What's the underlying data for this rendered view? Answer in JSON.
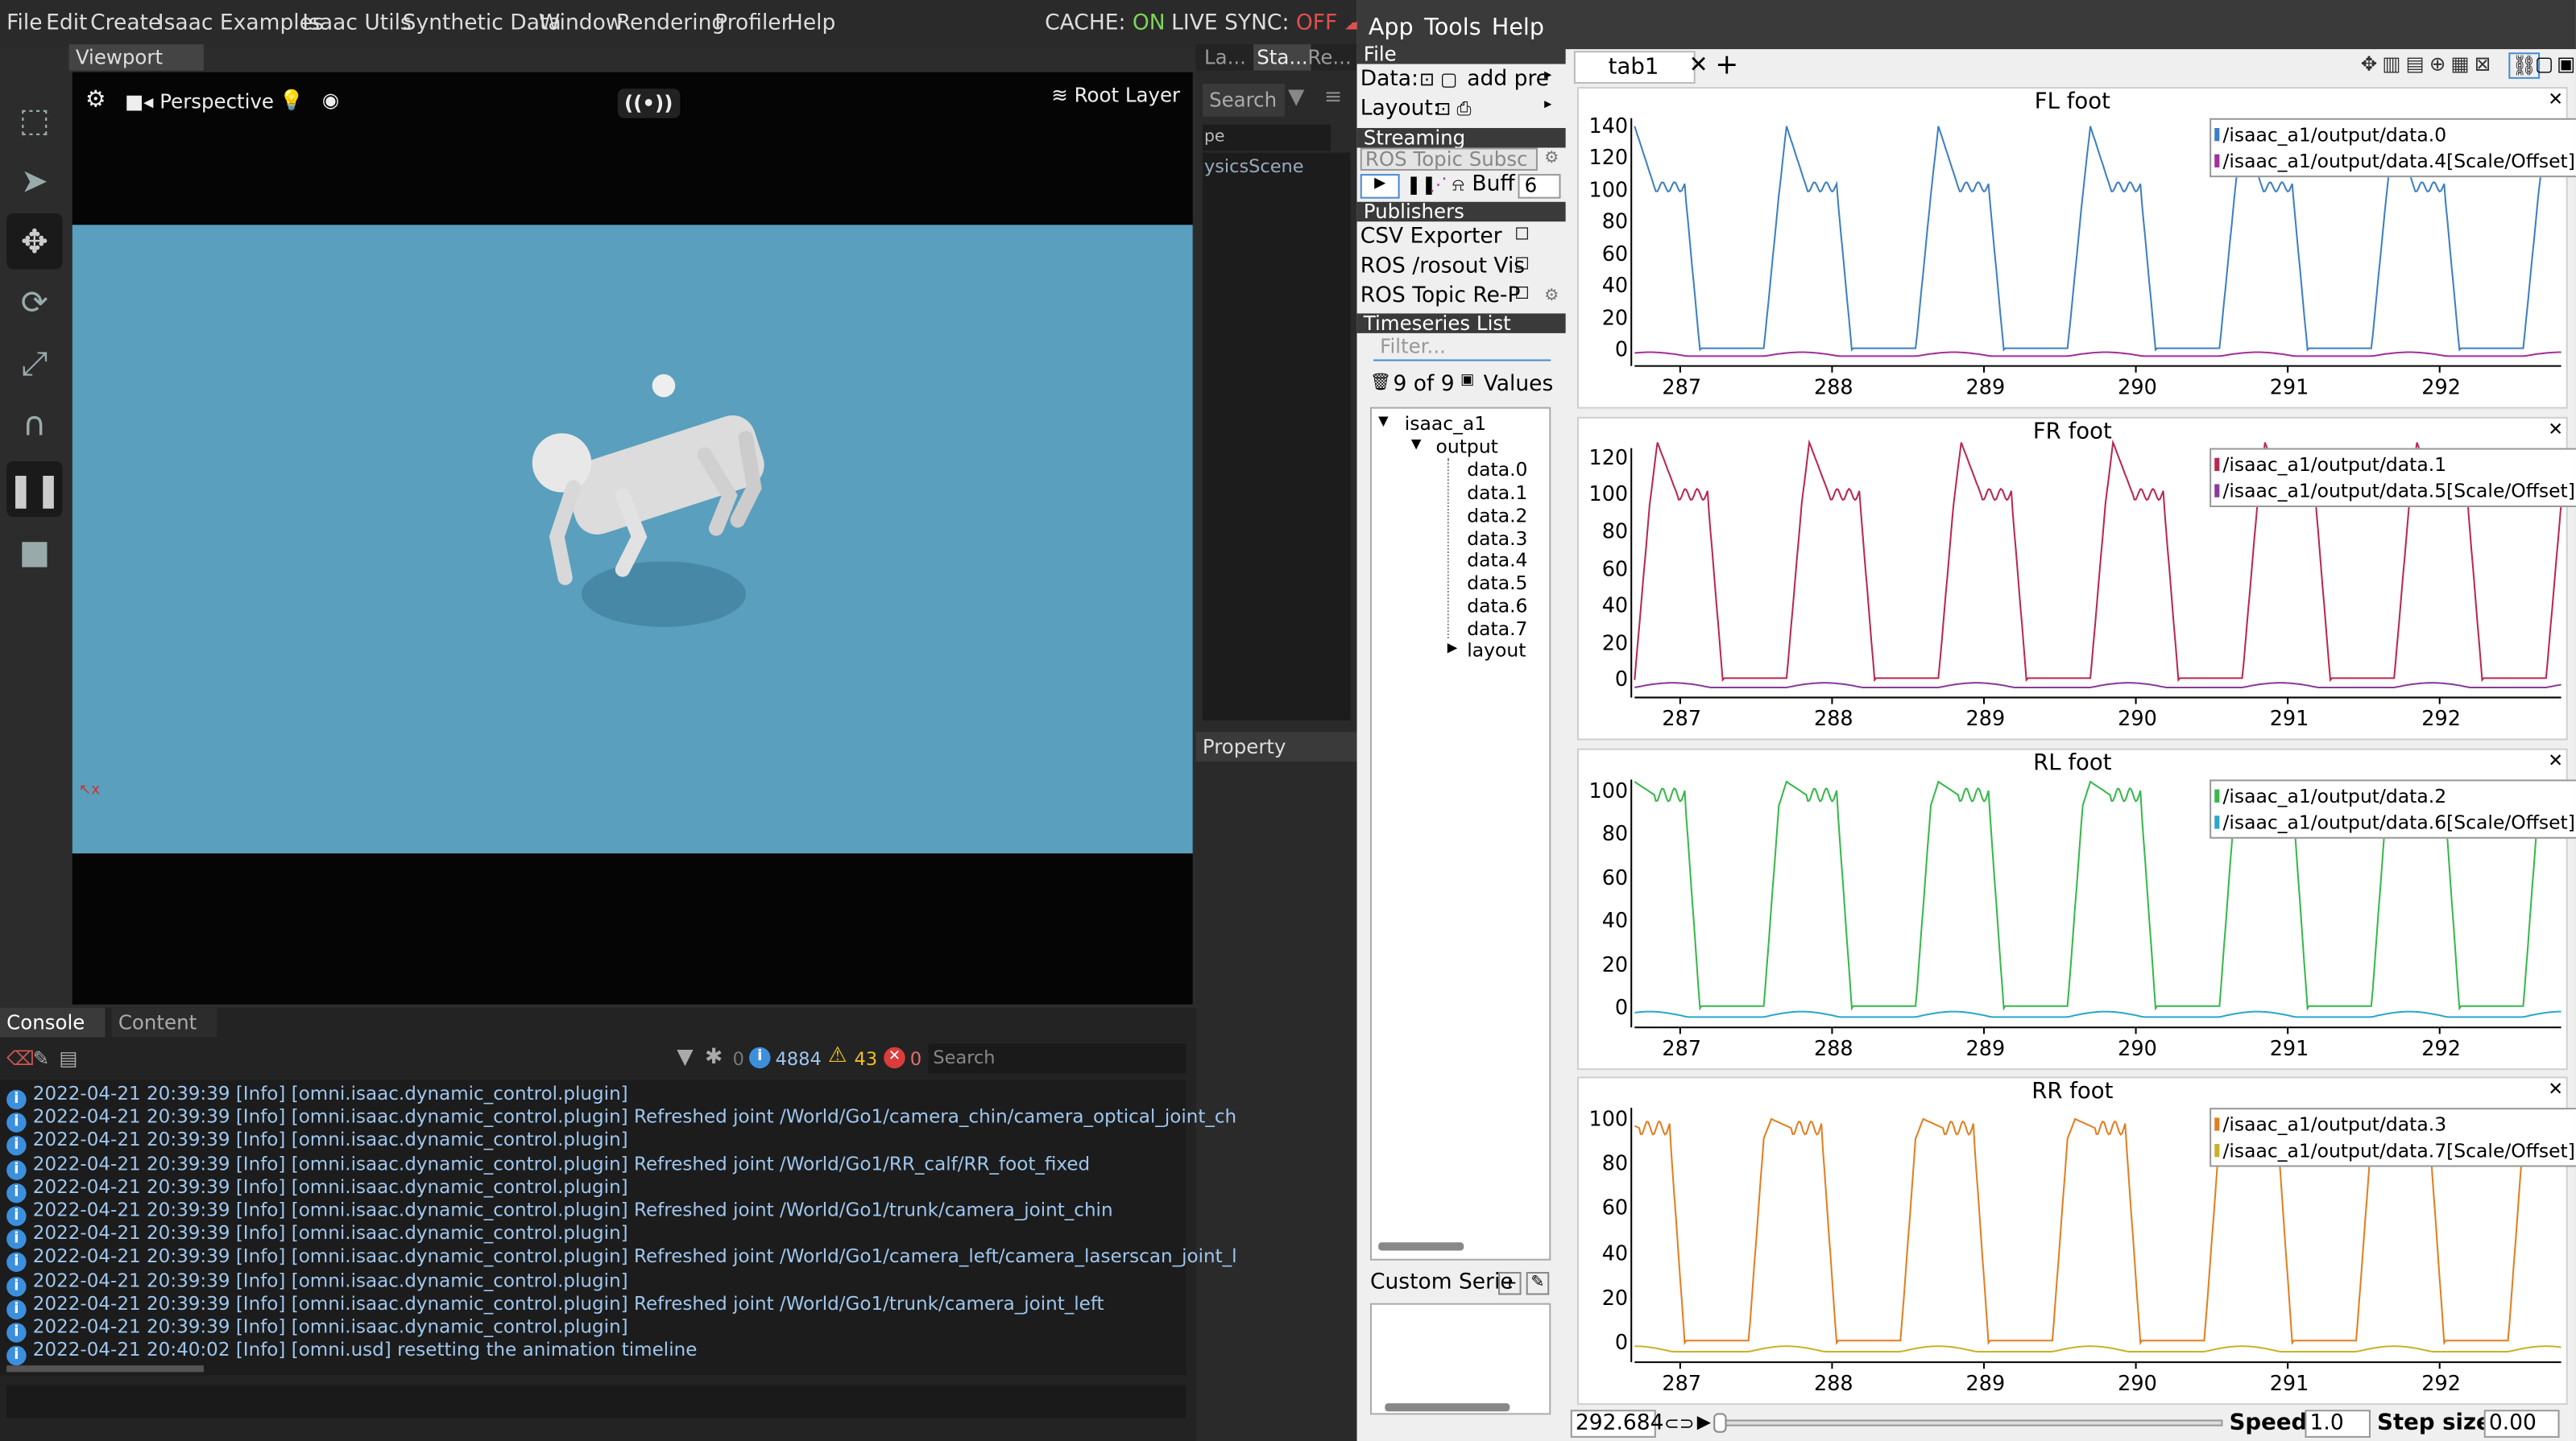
{
  "menu": {
    "items": [
      "File",
      "Edit",
      "Create",
      "Isaac Examples",
      "Isaac Utils",
      "Synthetic Data",
      "Window",
      "Rendering",
      "Profiler",
      "Help"
    ],
    "cache_label": "CACHE:",
    "cache_value": "ON",
    "live_label": "LIVE SYNC:",
    "live_value": "OFF"
  },
  "viewport": {
    "tab": "Viewport",
    "camera": "Perspective",
    "layer": "Root Layer"
  },
  "right_panel": {
    "tabs": [
      "La...",
      "Sta...",
      "Re..."
    ],
    "search": "Search",
    "row1": "pe",
    "row2": "ysicsScene",
    "property": "Property"
  },
  "console": {
    "tabs": [
      "Console",
      "Content"
    ],
    "count0": "0",
    "info_count": "4884",
    "warn_count": "43",
    "err_count": "0",
    "search": "Search",
    "lines": [
      "2022-04-21 20:39:39  [Info] [omni.isaac.dynamic_control.plugin]",
      "2022-04-21 20:39:39  [Info] [omni.isaac.dynamic_control.plugin] Refreshed joint /World/Go1/camera_chin/camera_optical_joint_ch",
      "2022-04-21 20:39:39  [Info] [omni.isaac.dynamic_control.plugin]",
      "2022-04-21 20:39:39  [Info] [omni.isaac.dynamic_control.plugin] Refreshed joint /World/Go1/RR_calf/RR_foot_fixed",
      "2022-04-21 20:39:39  [Info] [omni.isaac.dynamic_control.plugin]",
      "2022-04-21 20:39:39  [Info] [omni.isaac.dynamic_control.plugin] Refreshed joint /World/Go1/trunk/camera_joint_chin",
      "2022-04-21 20:39:39  [Info] [omni.isaac.dynamic_control.plugin]",
      "2022-04-21 20:39:39  [Info] [omni.isaac.dynamic_control.plugin] Refreshed joint /World/Go1/camera_left/camera_laserscan_joint_l",
      "2022-04-21 20:39:39  [Info] [omni.isaac.dynamic_control.plugin]",
      "2022-04-21 20:39:39  [Info] [omni.isaac.dynamic_control.plugin] Refreshed joint /World/Go1/trunk/camera_joint_left",
      "2022-04-21 20:39:39  [Info] [omni.isaac.dynamic_control.plugin]",
      "2022-04-21 20:40:02  [Info] [omni.usd] resetting the animation timeline"
    ]
  },
  "pj": {
    "menu": [
      "App",
      "Tools",
      "Help"
    ],
    "file": "File",
    "data_label": "Data:",
    "add": "add pre",
    "layout_label": "Layout:",
    "streaming": "Streaming",
    "ros_sub": "ROS Topic Subsc",
    "buff": "Buff",
    "buff_val": "6",
    "publishers": "Publishers",
    "pubs": [
      "CSV Exporter",
      "ROS /rosout Vis",
      "ROS Topic Re-P"
    ],
    "ts_list": "Timeseries List",
    "filter": "Filter...",
    "count": "9 of 9",
    "values": "Values",
    "tree": [
      "isaac_a1",
      "output",
      "data.0",
      "data.1",
      "data.2",
      "data.3",
      "data.4",
      "data.5",
      "data.6",
      "data.7",
      "layout"
    ],
    "custom": "Custom Serie",
    "tab": "tab1",
    "time": "292.684",
    "speed_label": "Speed:",
    "speed": "1.0",
    "step_label": "Step size:",
    "step": "0.00"
  },
  "chart_data": [
    {
      "type": "line",
      "title": "FL foot",
      "xlim": [
        286.7,
        292.8
      ],
      "ylim": [
        -5,
        145
      ],
      "xticks": [
        287,
        288,
        289,
        290,
        291,
        292
      ],
      "yticks": [
        0,
        20,
        40,
        60,
        80,
        100,
        120,
        140
      ],
      "series": [
        {
          "name": "/isaac_a1/output/data.0",
          "color": "#3d7fc4"
        },
        {
          "name": "/isaac_a1/output/data.4[Scale/Offset]",
          "color": "#a0309a"
        }
      ]
    },
    {
      "type": "line",
      "title": "FR foot",
      "xlim": [
        286.7,
        292.8
      ],
      "ylim": [
        -5,
        125
      ],
      "xticks": [
        287,
        288,
        289,
        290,
        291,
        292
      ],
      "yticks": [
        0,
        20,
        40,
        60,
        80,
        100,
        120
      ],
      "series": [
        {
          "name": "/isaac_a1/output/data.1",
          "color": "#b8294e"
        },
        {
          "name": "/isaac_a1/output/data.5[Scale/Offset]",
          "color": "#8a3a9a"
        }
      ]
    },
    {
      "type": "line",
      "title": "RL foot",
      "xlim": [
        286.7,
        292.8
      ],
      "ylim": [
        -5,
        105
      ],
      "xticks": [
        287,
        288,
        289,
        290,
        291,
        292
      ],
      "yticks": [
        0,
        20,
        40,
        60,
        80,
        100
      ],
      "series": [
        {
          "name": "/isaac_a1/output/data.2",
          "color": "#37b84a"
        },
        {
          "name": "/isaac_a1/output/data.6[Scale/Offset]",
          "color": "#2aa7c9"
        }
      ]
    },
    {
      "type": "line",
      "title": "RR foot",
      "xlim": [
        286.7,
        292.8
      ],
      "ylim": [
        -5,
        105
      ],
      "xticks": [
        287,
        288,
        289,
        290,
        291,
        292
      ],
      "yticks": [
        0,
        20,
        40,
        60,
        80,
        100
      ],
      "series": [
        {
          "name": "/isaac_a1/output/data.3",
          "color": "#e07f20"
        },
        {
          "name": "/isaac_a1/output/data.7[Scale/Offset]",
          "color": "#c9b22a"
        }
      ]
    }
  ]
}
